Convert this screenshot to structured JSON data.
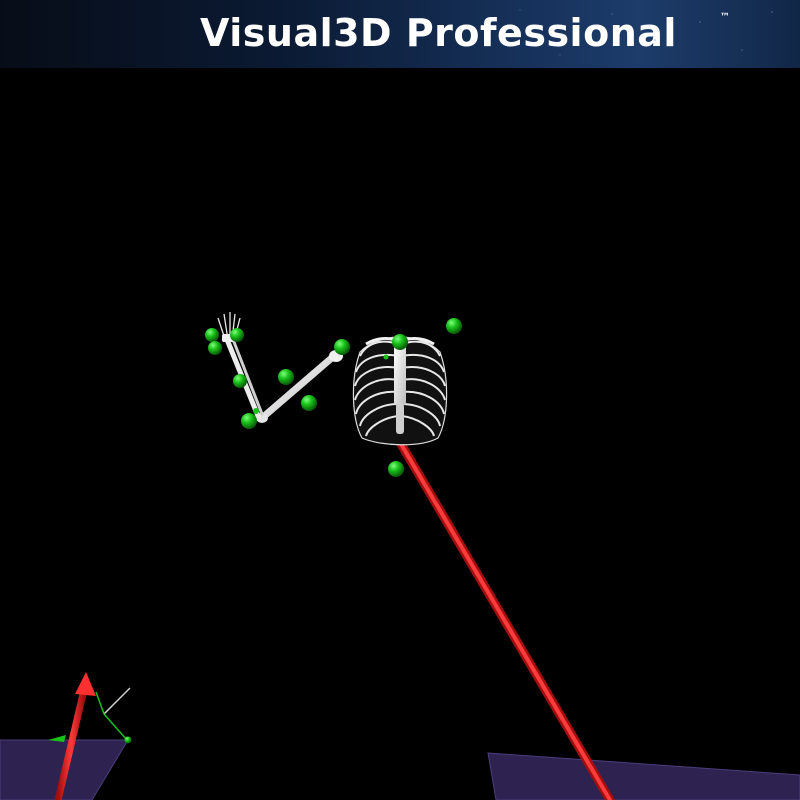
{
  "header": {
    "title": "Visual3D Professional",
    "trademark": "™"
  },
  "scene": {
    "background_color": "#000000",
    "marker_color": "#19c219",
    "bone_color": "#eeeeee",
    "force_vector_color": "#e31b1b",
    "force_plate_color": "#2e2350",
    "axis_colors": {
      "x": "#e31b1b",
      "y": "#19c219",
      "z": "#d4d4d4"
    },
    "objects": [
      {
        "name": "force-plate-left"
      },
      {
        "name": "force-plate-right"
      },
      {
        "name": "lab-coordinate-axes"
      },
      {
        "name": "ground-reaction-force-vector"
      },
      {
        "name": "rib-cage-model"
      },
      {
        "name": "upper-arm-bone"
      },
      {
        "name": "forearm-bones"
      },
      {
        "name": "hand-bones"
      },
      {
        "name": "motion-capture-markers",
        "count": 13
      }
    ]
  }
}
